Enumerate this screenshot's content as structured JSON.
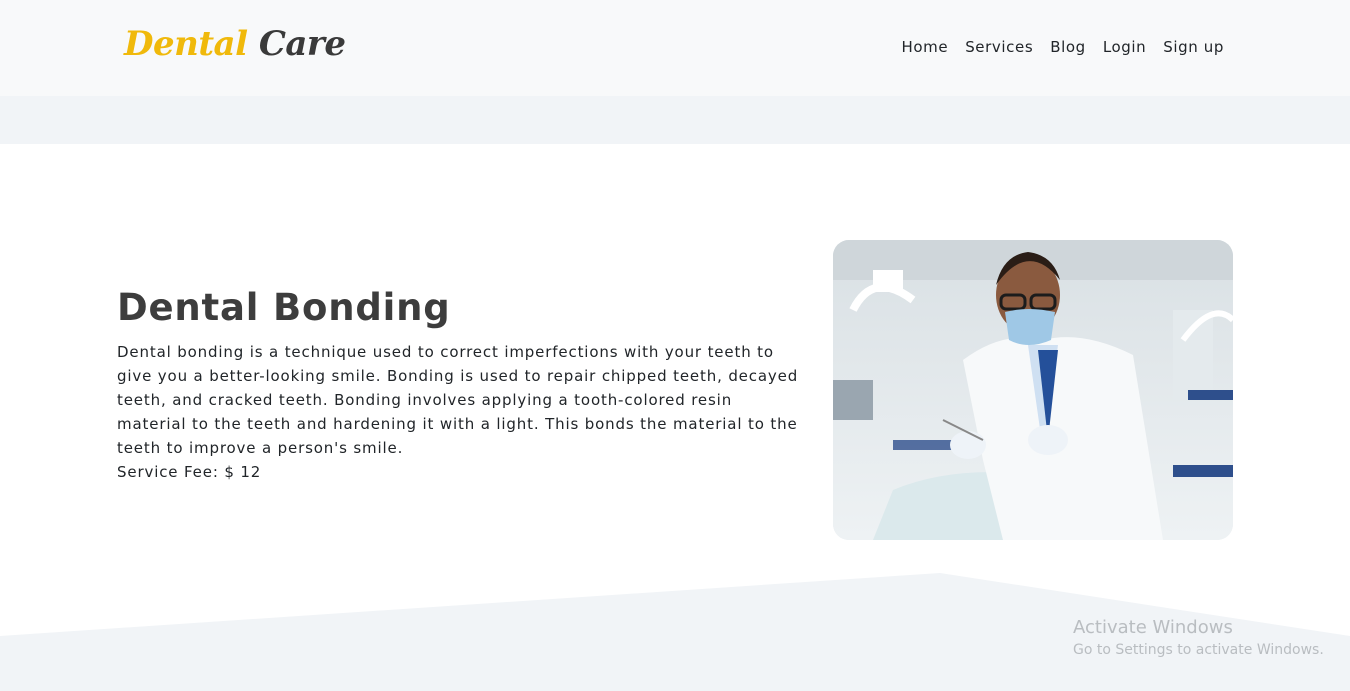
{
  "brand": {
    "word1": "Dental",
    "word2": "Care"
  },
  "nav": {
    "items": [
      "Home",
      "Services",
      "Blog",
      "Login",
      "Sign up"
    ]
  },
  "service": {
    "title": "Dental Bonding",
    "description": "Dental bonding is a technique used to correct imperfections with your teeth to give you a better-looking smile. Bonding is used to repair chipped teeth, decayed teeth, and cracked teeth. Bonding involves applying a tooth-colored resin material to the teeth and hardening it with a light. This bonds the material to the teeth to improve a person's smile.",
    "fee": "Service Fee: $ 12"
  },
  "watermark": {
    "line1": "Activate Windows",
    "line2": "Go to Settings to activate Windows."
  },
  "colors": {
    "brand_accent": "#f0b90b",
    "brand_dark": "#3a3a3a",
    "navbar_bg": "#f8f9fa",
    "band_bg": "#f1f4f7"
  }
}
